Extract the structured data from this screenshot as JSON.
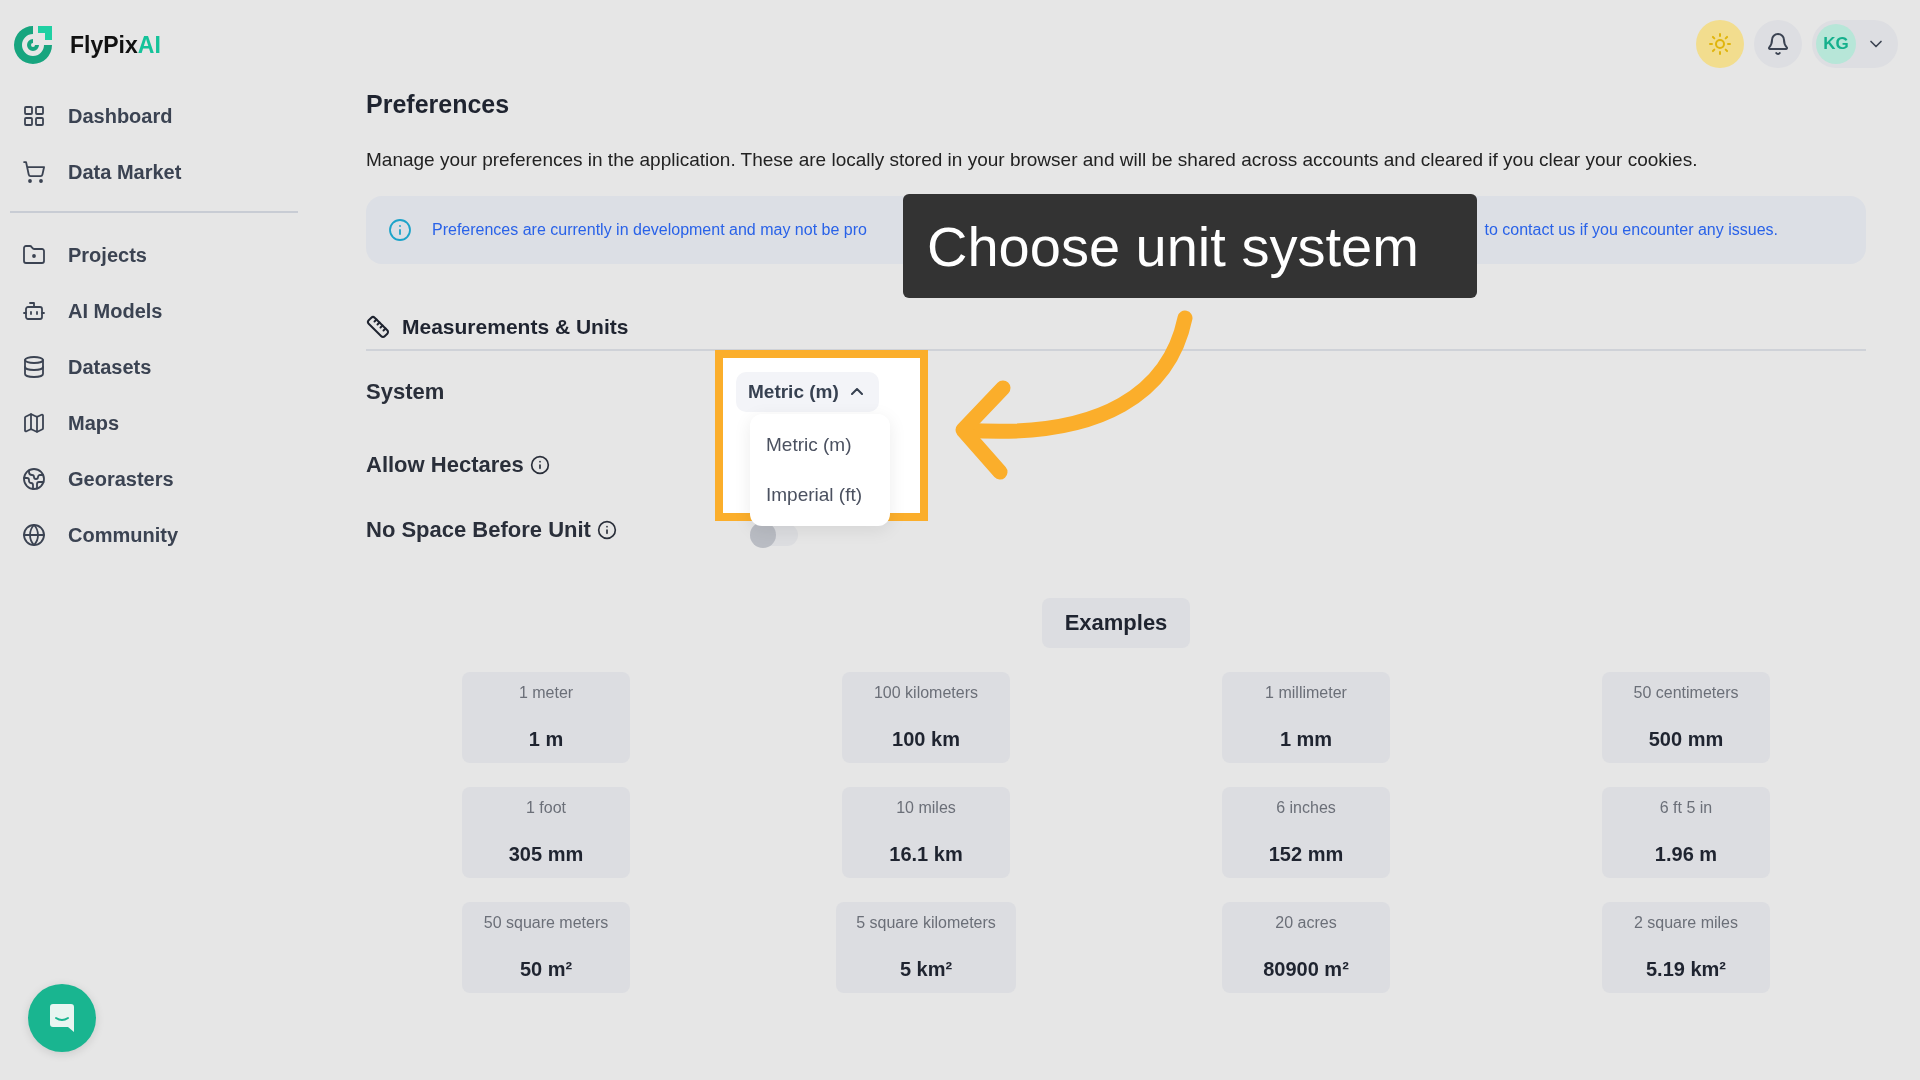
{
  "brand": {
    "name": "FlyPix",
    "accent": "AI"
  },
  "header": {
    "avatar": "KG"
  },
  "sidebar": {
    "groups": [
      {
        "items": [
          {
            "label": "Dashboard",
            "kind": "dashboard"
          },
          {
            "label": "Data Market",
            "kind": "cart"
          }
        ]
      },
      {
        "items": [
          {
            "label": "Projects",
            "kind": "folder"
          },
          {
            "label": "AI Models",
            "kind": "bot"
          },
          {
            "label": "Datasets",
            "kind": "database"
          },
          {
            "label": "Maps",
            "kind": "map"
          },
          {
            "label": "Georasters",
            "kind": "earth"
          },
          {
            "label": "Community",
            "kind": "globe"
          }
        ]
      }
    ]
  },
  "page": {
    "title": "Preferences",
    "description": "Manage your preferences in the application. These are locally stored in your browser and will be shared across accounts and cleared if you clear your cookies.",
    "notice": {
      "text_before": "Preferences are currently in development and may not be pro",
      "text_after": "to contact us if you encounter any issues."
    },
    "section": {
      "title": "Measurements & Units"
    },
    "settings": [
      {
        "kind": "select",
        "label": "System",
        "value": "Metric (m)",
        "expanded": true,
        "options": [
          "Metric (m)",
          "Imperial (ft)"
        ]
      },
      {
        "kind": "label",
        "label": "Allow Hectares"
      },
      {
        "kind": "toggle",
        "label": "No Space Before Unit",
        "on": false
      }
    ],
    "examples": {
      "title": "Examples",
      "items": [
        {
          "label": "1 meter",
          "value": "1 m"
        },
        {
          "label": "100 kilometers",
          "value": "100 km"
        },
        {
          "label": "1 millimeter",
          "value": "1 mm"
        },
        {
          "label": "50 centimeters",
          "value": "500 mm"
        },
        {
          "label": "1 foot",
          "value": "305 mm"
        },
        {
          "label": "10 miles",
          "value": "16.1 km"
        },
        {
          "label": "6 inches",
          "value": "152 mm"
        },
        {
          "label": "6 ft 5 in",
          "value": "1.96 m"
        },
        {
          "label": "50 square meters",
          "value": "50 m²"
        },
        {
          "label": "5 square kilometers",
          "value": "5 km²"
        },
        {
          "label": "20 acres",
          "value": "80900 m²"
        },
        {
          "label": "2 square miles",
          "value": "5.19 km²"
        }
      ]
    }
  },
  "tooltip": {
    "text": "Choose unit system"
  }
}
